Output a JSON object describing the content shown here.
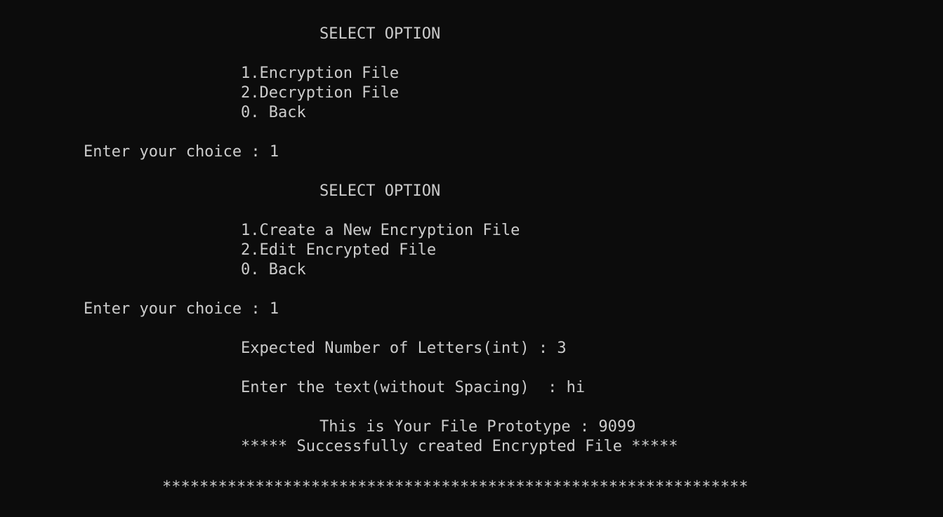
{
  "terminal": {
    "lines": [
      {
        "id": "title-1",
        "text": "SELECT OPTION"
      },
      {
        "id": "menu1-opt1",
        "text": "1.Encryption File"
      },
      {
        "id": "menu1-opt2",
        "text": "2.Decryption File"
      },
      {
        "id": "menu1-back",
        "text": "0. Back"
      },
      {
        "id": "prompt-1",
        "text": "Enter your choice : 1"
      },
      {
        "id": "title-2",
        "text": "SELECT OPTION"
      },
      {
        "id": "menu2-opt1",
        "text": "1.Create a New Encryption File"
      },
      {
        "id": "menu2-opt2",
        "text": "2.Edit Encrypted File"
      },
      {
        "id": "menu2-back",
        "text": "0. Back"
      },
      {
        "id": "prompt-2",
        "text": "Enter your choice : 1"
      },
      {
        "id": "expected-letters",
        "text": "Expected Number of Letters(int) : 3"
      },
      {
        "id": "enter-text",
        "text": "Enter the text(without Spacing)  : hi"
      },
      {
        "id": "file-prototype",
        "text": "This is Your File Prototype : 9099"
      },
      {
        "id": "success-message",
        "text": "***** Successfully created Encrypted File *****"
      },
      {
        "id": "separator",
        "text": "***************************************************************"
      }
    ]
  }
}
